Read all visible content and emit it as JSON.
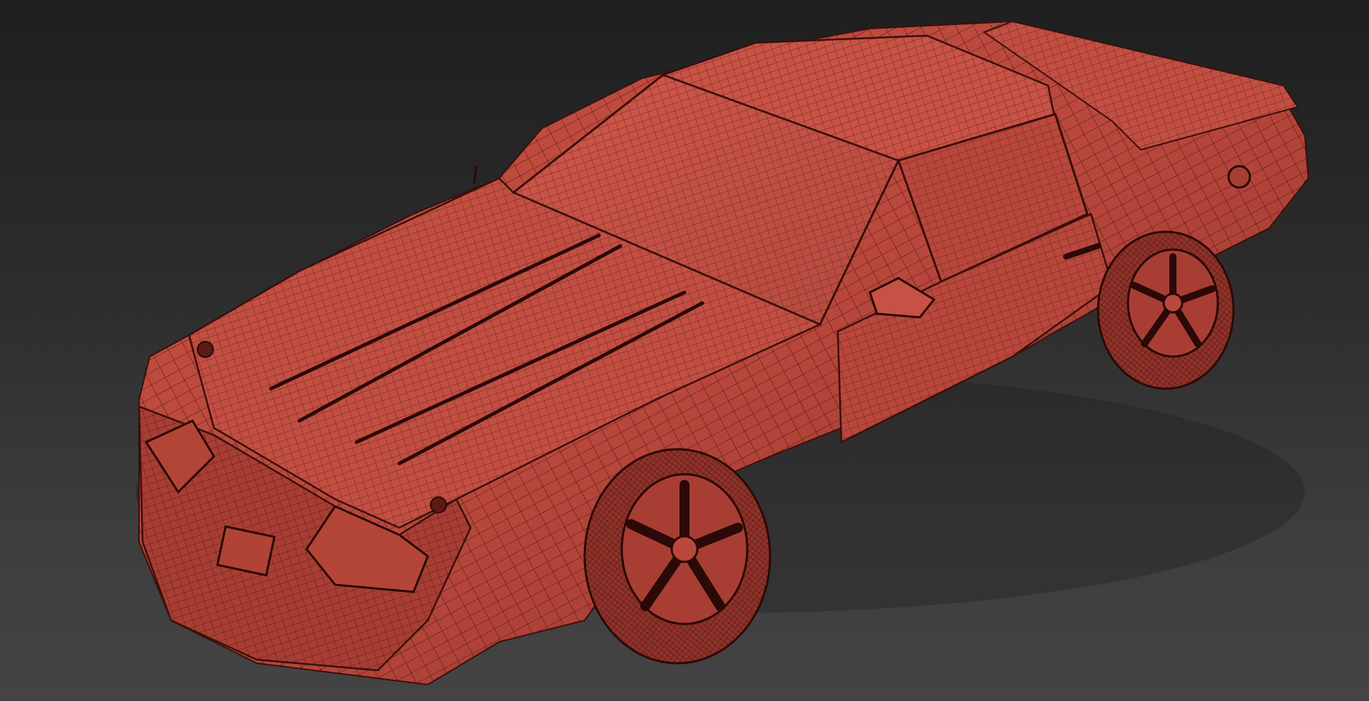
{
  "viewport": {
    "background_top": "#1f1f1f",
    "background_bottom": "#444444"
  },
  "model": {
    "shading": "wireframe-on-shaded",
    "surface_color": "#b9473c",
    "surface_light": "#d0574a",
    "surface_dark": "#7e2a24",
    "wire_color": "#3a0f0c"
  }
}
